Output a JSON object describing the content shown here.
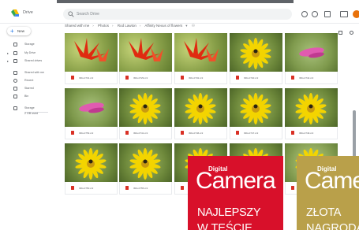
{
  "app": {
    "title": "Drive",
    "search_placeholder": "Search Drive"
  },
  "sidebar": {
    "new_label": "New",
    "items": [
      {
        "label": "Storage",
        "icon": "home-icon"
      },
      {
        "label": "My Drive",
        "icon": "drive-icon"
      },
      {
        "label": "Shared drives",
        "icon": "shared-drives-icon"
      },
      {
        "label": "Shared with me",
        "icon": "people-icon"
      },
      {
        "label": "Recent",
        "icon": "clock-icon"
      },
      {
        "label": "Starred",
        "icon": "star-icon"
      },
      {
        "label": "Bin",
        "icon": "bin-icon"
      },
      {
        "label": "Storage",
        "icon": "cloud-icon"
      },
      {
        "label": "2 GB used",
        "icon": ""
      }
    ]
  },
  "breadcrumb": [
    "Shared with me",
    "Photos",
    "Rod Lawton",
    "Affinity Nexus of flowers"
  ],
  "files": [
    {
      "name": "IMG-0731.cr2",
      "scene": "red"
    },
    {
      "name": "IMG-0729.cr2",
      "scene": "red"
    },
    {
      "name": "IMG-0732.cr2",
      "scene": "red"
    },
    {
      "name": "IMG-0740.cr2",
      "scene": "yellow"
    },
    {
      "name": "IMG-0742.cr2",
      "scene": "pink"
    },
    {
      "name": "IMG-0753.cr2",
      "scene": "pink"
    },
    {
      "name": "IMG-0741.cr2",
      "scene": "yellow"
    },
    {
      "name": "IMG-0746.cr2",
      "scene": "yellow"
    },
    {
      "name": "IMG-0747.cr2",
      "scene": "yellow"
    },
    {
      "name": "IMG-0749.cr2",
      "scene": "yellow"
    },
    {
      "name": "IMG-0750.cr2",
      "scene": "yellow"
    },
    {
      "name": "IMG-0755.cr2",
      "scene": "yellow"
    },
    {
      "name": "",
      "scene": "yellow"
    },
    {
      "name": "",
      "scene": "yellow"
    },
    {
      "name": "",
      "scene": "green"
    }
  ],
  "badges": [
    {
      "brand": "Digital",
      "name": "Camera",
      "award_line1": "NAJLEPSZY",
      "award_line2": "W TEŚCIE",
      "color": "#d8102a"
    },
    {
      "brand": "Digital",
      "name": "Camera",
      "award_line1": "ZŁOTA",
      "award_line2": "NAGRODA",
      "color": "#b9a04a"
    }
  ]
}
